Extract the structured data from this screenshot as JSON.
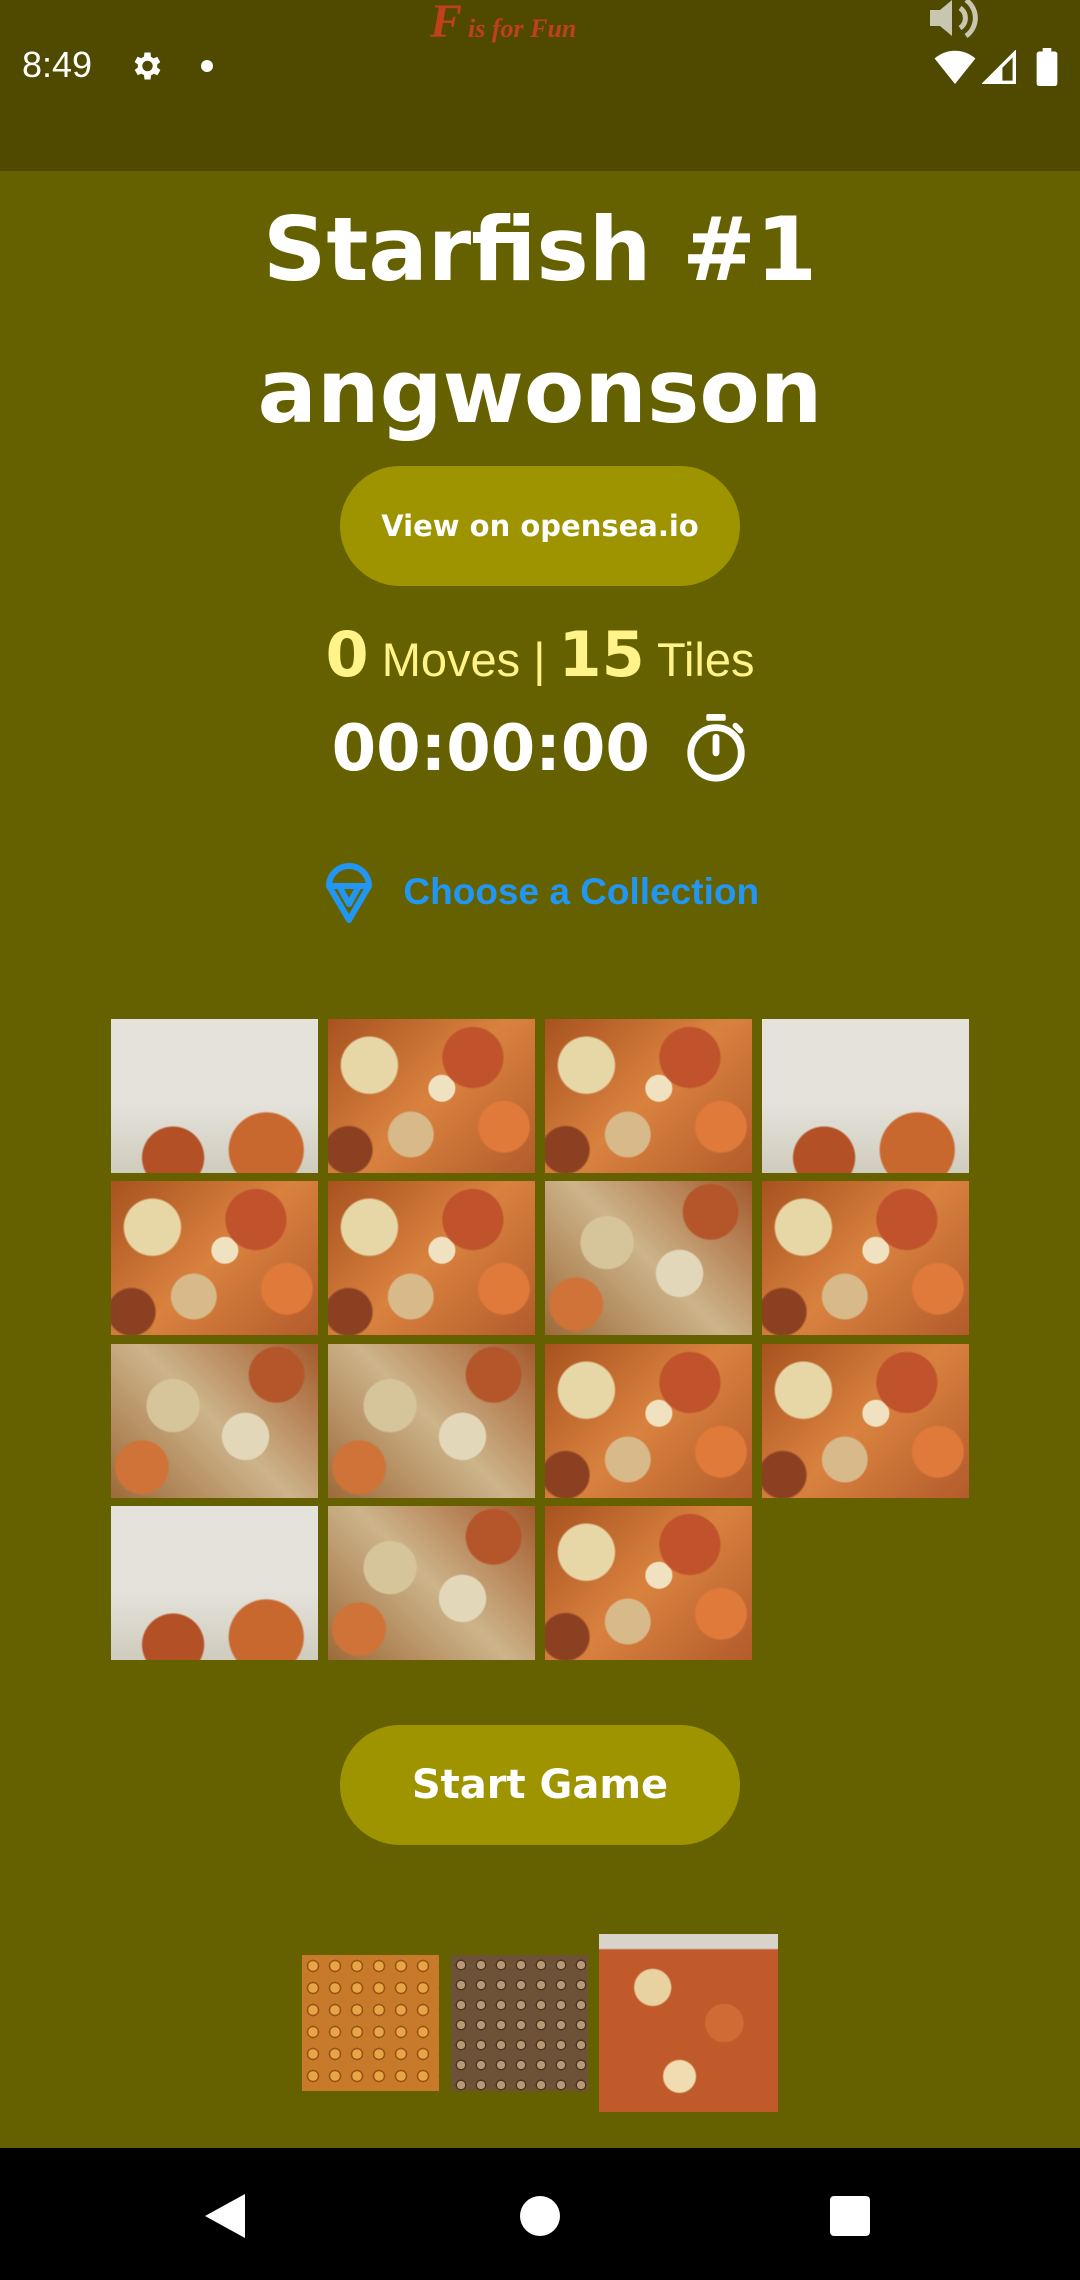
{
  "status_bar": {
    "time": "8:49",
    "brand_big": "F",
    "brand_small": "is for Fun",
    "icons": [
      "gear-icon",
      "notification-dot",
      "speaker-icon",
      "wifi-icon",
      "signal-icon",
      "battery-icon"
    ]
  },
  "header": {
    "title": "Starfish #1",
    "subtitle": "angwonson",
    "opensea_button": "View on opensea.io"
  },
  "stats": {
    "moves_value": "0",
    "moves_label": "Moves |",
    "tiles_value": "15",
    "tiles_label": "Tiles",
    "timer": "00:00:00"
  },
  "collection": {
    "label": "Choose a Collection",
    "icon": "ice-cream-icon"
  },
  "puzzle": {
    "grid": "4x4",
    "tiles_count": 15,
    "empty_slot": "row 4, column 4"
  },
  "actions": {
    "start_button": "Start Game"
  },
  "thumbnails": [
    {
      "name": "collection-thumb-1"
    },
    {
      "name": "collection-thumb-2"
    },
    {
      "name": "collection-thumb-3-selected"
    }
  ],
  "colors": {
    "background": "#666100",
    "status_bar": "#4f4a00",
    "button": "#9d9400",
    "stats_text": "#fff389",
    "link": "#2196f3"
  }
}
